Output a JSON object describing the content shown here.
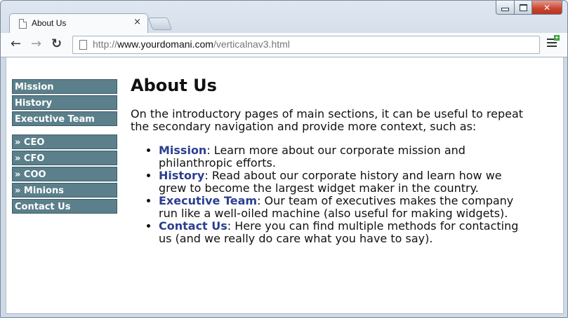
{
  "browser": {
    "tab_title": "About Us",
    "tab_close": "×",
    "url_prefix": "http://",
    "url_host": "www.yourdomani.com",
    "url_path": "/verticalnav3.html",
    "icons": {
      "back": "back-arrow-icon",
      "forward": "forward-arrow-icon",
      "reload": "reload-icon",
      "menu": "menu-icon"
    }
  },
  "sidenav": {
    "primary": [
      "Mission",
      "History",
      "Executive Team"
    ],
    "secondary": [
      "» CEO",
      "» CFO",
      "» COO",
      "» Minions",
      "Contact Us"
    ],
    "colors": {
      "background": "#5b7f8b",
      "border": "#3d5d68",
      "text": "#ffffff"
    }
  },
  "main": {
    "title": "About Us",
    "intro": "On the introductory pages of main sections, it can be useful to repeat the secondary navigation and provide more context, such as:",
    "items": [
      {
        "link": "Mission",
        "text": ": Learn more about our corporate mission and philanthropic efforts."
      },
      {
        "link": "History",
        "text": ": Read about our corporate history and learn how we grew to become the largest widget maker in the country."
      },
      {
        "link": "Executive Team",
        "text": ": Our team of executives makes the company run like a well-oiled machine (also useful for making widgets)."
      },
      {
        "link": "Contact Us",
        "text": ": Here you can find multiple methods for contacting us (and we really do care what you have to say)."
      }
    ],
    "link_color": "#2b3f8f"
  }
}
